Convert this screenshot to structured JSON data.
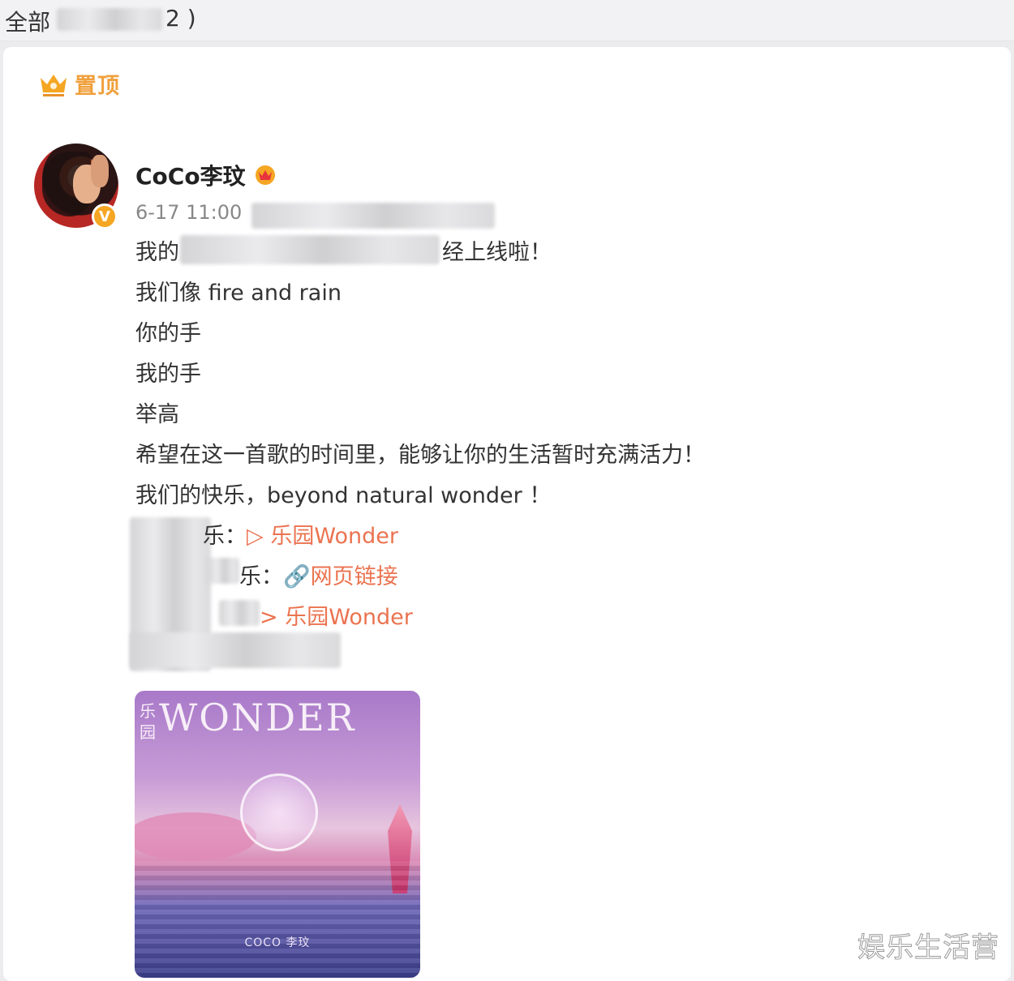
{
  "header": {
    "label": "全部",
    "count_suffix": "2 )"
  },
  "pinned": {
    "label": "置顶",
    "icon": "crown-icon"
  },
  "post": {
    "author": "CoCo李玟",
    "verified_icon": "verified-badge-icon",
    "vip_icon": "vip-crown-icon",
    "timestamp": "6-17 11:00",
    "lines": [
      "我的",
      "经上线啦！",
      "我们像 fire and rain",
      "你的手",
      "我的手",
      "举高",
      "希望在这一首歌的时间里，能够让你的生活暂时充满活力！",
      "我们的快乐，beyond natural wonder ！"
    ],
    "links": [
      {
        "prefix": "乐：",
        "icon": "play-icon",
        "text": "▷ 乐园Wonder"
      },
      {
        "prefix": "乐：",
        "icon": "link-icon",
        "text": "网页链接"
      },
      {
        "prefix": "",
        "icon": "play-icon",
        "text": "> 乐园Wonder"
      }
    ],
    "image": {
      "title": "WONDER",
      "side_text": "乐园",
      "artist": "COCO 李玟"
    }
  },
  "watermark": "娱乐生活营",
  "colors": {
    "link": "#eb7350",
    "pinned": "#f0a03c",
    "verified": "#f5a623"
  }
}
